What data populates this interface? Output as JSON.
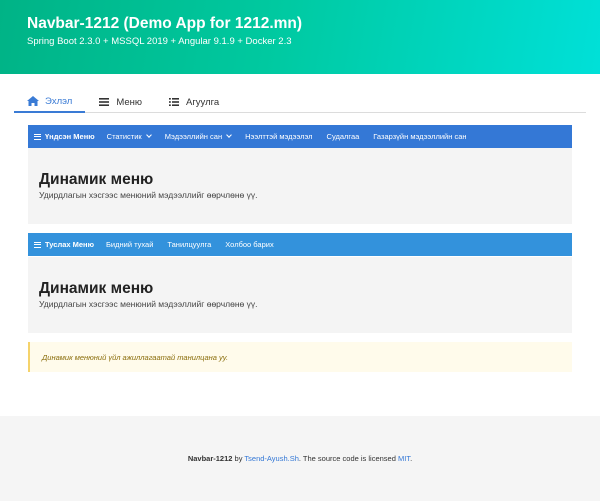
{
  "header": {
    "title": "Navbar-1212 (Demo App for 1212.mn)",
    "subtitle": "Spring Boot 2.3.0 + MSSQL 2019 + Angular 9.1.9 + Docker 2.3"
  },
  "tabs": [
    {
      "label": "Эхлэл",
      "icon": "home-icon",
      "active": true
    },
    {
      "label": "Меню",
      "icon": "menu-icon",
      "active": false
    },
    {
      "label": "Агуулга",
      "icon": "list-icon",
      "active": false
    }
  ],
  "navbar_primary": {
    "brand": "Үндсэн Меню",
    "items": [
      "Статистик",
      "Мэдээллийн сан",
      "Нээлттэй мэдээлэл",
      "Судалгаа",
      "Газарзүйн мэдээллийн сан"
    ]
  },
  "panel1": {
    "title": "Динамик меню",
    "text": "Удирдлагын хэсгээс менюний мэдээллийг өөрчлөнө үү."
  },
  "navbar_secondary": {
    "brand": "Туслах Меню",
    "items": [
      "Бидний тухай",
      "Танилцуулга",
      "Холбоо барих"
    ]
  },
  "panel2": {
    "title": "Динамик меню",
    "text": "Удирдлагын хэсгээс менюний мэдээллийг өөрчлөнө үү."
  },
  "notice": {
    "text": "Динамик менюний үйл ажиллагаатай танилцана уу."
  },
  "footer": {
    "app_name": "Navbar-1212",
    "by": " by ",
    "author": "Tsend-Ayush.Sh",
    "license_text": ". The source code is licensed ",
    "license": "MIT",
    "end": "."
  },
  "colors": {
    "accent": "#3478d6",
    "navbar_primary": "#3478d6",
    "navbar_secondary": "#3392dc",
    "hero_start": "#00b386",
    "hero_end": "#00e0d8"
  }
}
